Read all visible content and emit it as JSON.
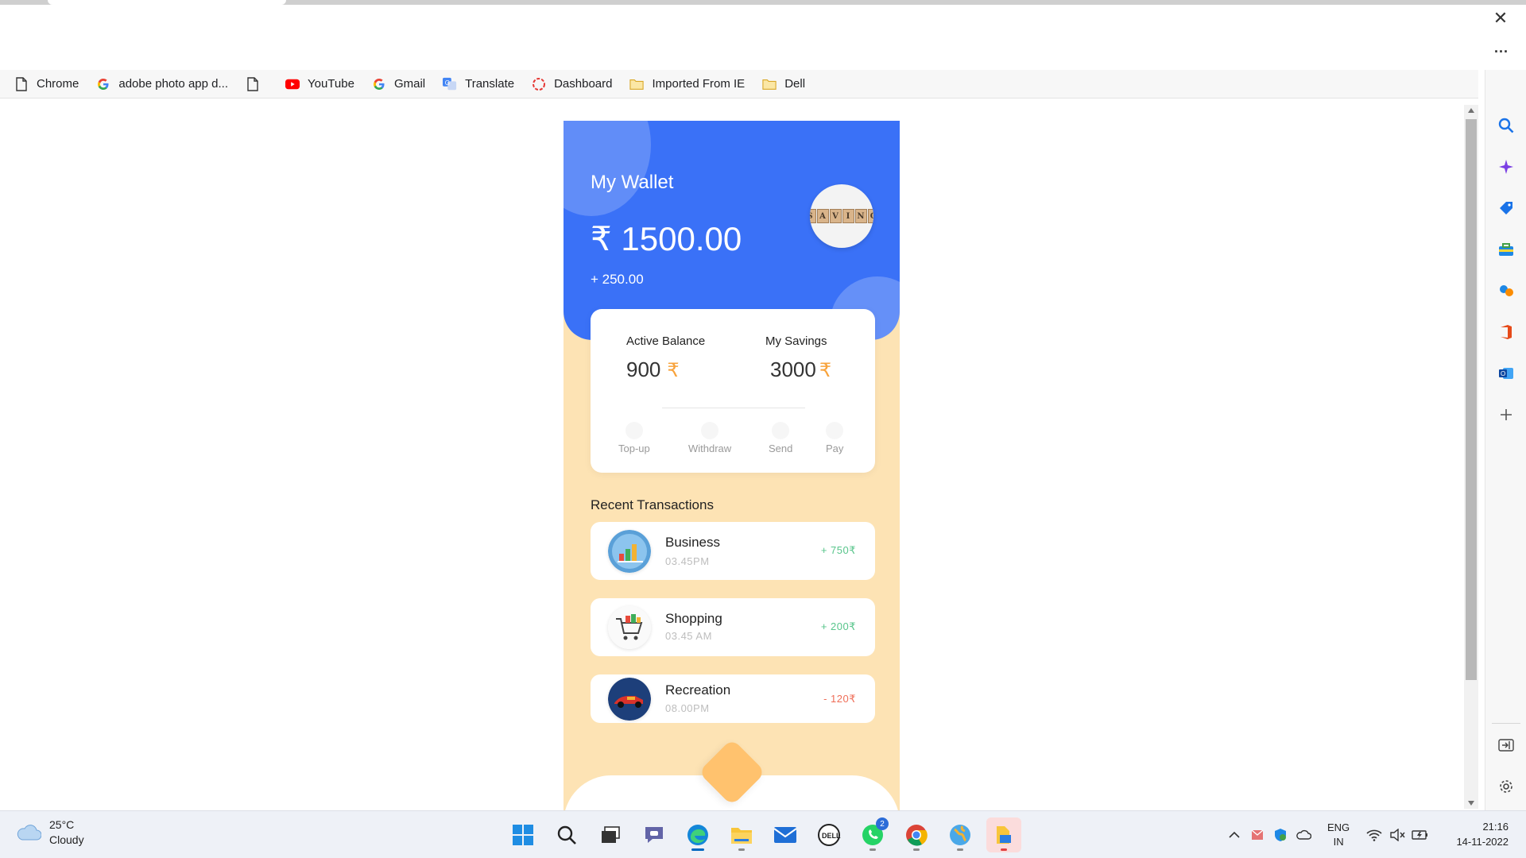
{
  "browser": {
    "bookmarks": [
      {
        "label": "Chrome",
        "icon": "page-icon"
      },
      {
        "label": "adobe photo app d...",
        "icon": "google-icon"
      },
      {
        "label": "",
        "icon": "page-icon"
      },
      {
        "label": "YouTube",
        "icon": "youtube-icon"
      },
      {
        "label": "Gmail",
        "icon": "google-icon"
      },
      {
        "label": "Translate",
        "icon": "translate-icon"
      },
      {
        "label": "Dashboard",
        "icon": "dashboard-icon"
      },
      {
        "label": "Imported From IE",
        "icon": "folder-icon"
      },
      {
        "label": "Dell",
        "icon": "folder-icon"
      }
    ],
    "more_label": "...",
    "close_label": "✕"
  },
  "wallet": {
    "title": "My Wallet",
    "amount": "₹ 1500.00",
    "change": "+ 250.00",
    "avatar_letters": [
      "S",
      "A",
      "V",
      "I",
      "N",
      "G"
    ]
  },
  "balance": {
    "active_label": "Active Balance",
    "active_value": "900",
    "savings_label": "My Savings",
    "savings_value": "3000",
    "currency": "₹",
    "actions": [
      "Top-up",
      "Withdraw",
      "Send",
      "Pay"
    ]
  },
  "transactions": {
    "title": "Recent Transactions",
    "items": [
      {
        "name": "Business",
        "time": "03.45PM",
        "amount": "+ 750₹",
        "type": "credit"
      },
      {
        "name": "Shopping",
        "time": "03.45 AM",
        "amount": "+ 200₹",
        "type": "credit"
      },
      {
        "name": "Recreation",
        "time": "08.00PM",
        "amount": "- 120₹",
        "type": "debit"
      }
    ]
  },
  "taskbar": {
    "weather_temp": "25°C",
    "weather_desc": "Cloudy",
    "whatsapp_badge": "2",
    "lang_1": "ENG",
    "lang_2": "IN",
    "time": "21:16",
    "date": "14-11-2022"
  },
  "colors": {
    "wallet_blue": "#3a71f7",
    "app_background": "#fde3b4",
    "accent_orange": "#ffc26e",
    "credit_green": "#58c58b",
    "debit_red": "#ef6e58"
  }
}
